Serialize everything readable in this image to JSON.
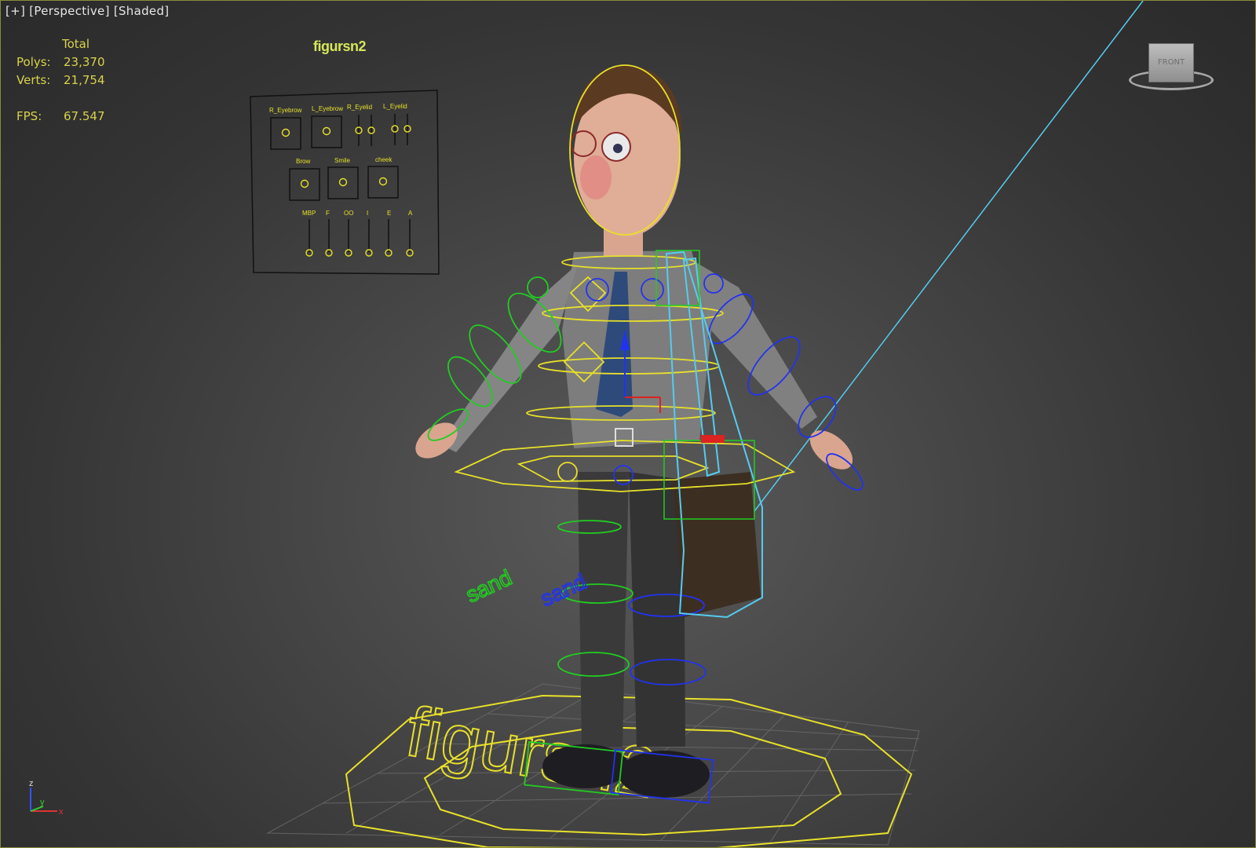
{
  "viewport": {
    "label_parts": [
      "[+]",
      "[Perspective]",
      "[Shaded]"
    ]
  },
  "stats": {
    "header": "Total",
    "polys_label": "Polys:",
    "polys_value": "23,370",
    "verts_label": "Verts:",
    "verts_value": "21,754",
    "fps_label": "FPS:",
    "fps_value": "67.547"
  },
  "controls": {
    "title": "figursn2",
    "row1": [
      "R_Eyebrow",
      "L_Eyebrow",
      "R_Eyelid",
      "L_Eyelid"
    ],
    "row2": [
      "Brow",
      "Smile",
      "cheek"
    ],
    "row3": [
      "MBP",
      "F",
      "OO",
      "I",
      "E",
      "A"
    ]
  },
  "scene": {
    "ground_text": "figursn2",
    "foot_label_left": "sand",
    "foot_label_right": "sand"
  },
  "viewcube": {
    "label": "FRONT"
  },
  "axis_tripod": {
    "z": "z",
    "y": "y",
    "x": "x"
  },
  "colors": {
    "stats_text": "#d9d24a",
    "rig_yellow": "#e8e02a",
    "rig_green": "#22cc22",
    "rig_blue": "#2233ee",
    "rig_cyan": "#55ccee"
  }
}
